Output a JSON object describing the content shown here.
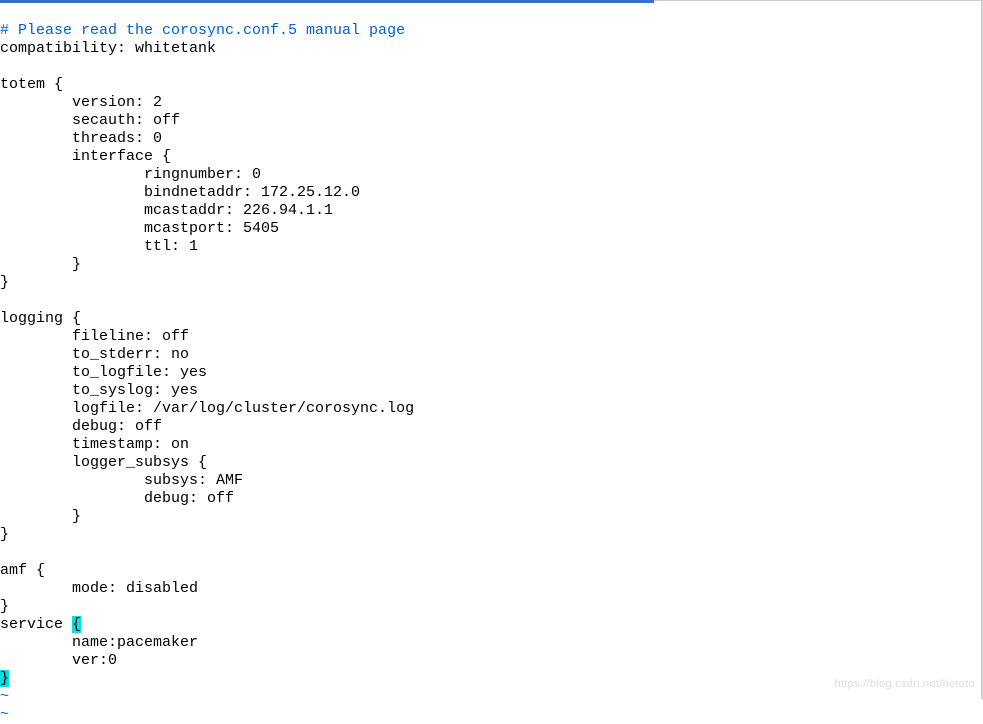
{
  "editor": {
    "comment_line": "# Please read the corosync.conf.5 manual page",
    "lines": {
      "compatibility": "compatibility: whitetank",
      "blank1": "",
      "totem_open": "totem {",
      "version": "        version: 2",
      "secauth": "        secauth: off",
      "threads": "        threads: 0",
      "interface_open": "        interface {",
      "ringnumber": "                ringnumber: 0",
      "bindnetaddr": "                bindnetaddr: 172.25.12.0",
      "mcastaddr": "                mcastaddr: 226.94.1.1",
      "mcastport": "                mcastport: 5405",
      "ttl": "                ttl: 1",
      "interface_close": "        }",
      "totem_close": "}",
      "blank2": "",
      "logging_open": "logging {",
      "fileline": "        fileline: off",
      "to_stderr": "        to_stderr: no",
      "to_logfile": "        to_logfile: yes",
      "to_syslog": "        to_syslog: yes",
      "logfile": "        logfile: /var/log/cluster/corosync.log",
      "debug": "        debug: off",
      "timestamp": "        timestamp: on",
      "logger_subsys_open": "        logger_subsys {",
      "subsys": "                subsys: AMF",
      "subsys_debug": "                debug: off",
      "logger_subsys_close": "        }",
      "logging_close": "}",
      "blank3": "",
      "amf_open": "amf {",
      "amf_mode": "        mode: disabled",
      "amf_close": "}",
      "service_prefix": "service ",
      "service_brace": "{",
      "service_name": "        name:pacemaker",
      "service_ver": "        ver:0",
      "service_close": "}",
      "tilde1": "~",
      "tilde2": "~"
    }
  },
  "watermark": "https://blog.csdn.net/hetoto"
}
